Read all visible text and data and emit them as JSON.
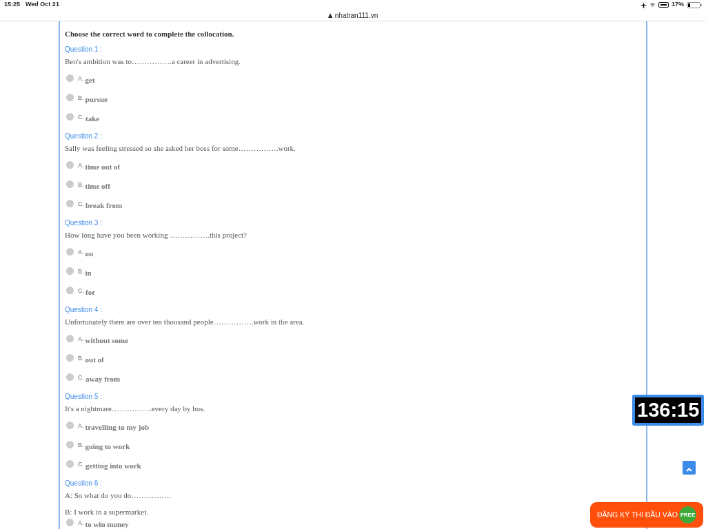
{
  "status_bar": {
    "time": "15:25",
    "date": "Wed Oct 21",
    "battery": "17%"
  },
  "address_bar": {
    "url": "nhatran111.vn"
  },
  "quiz": {
    "instruction": "Choose the correct word to complete the collocation.",
    "questions": [
      {
        "label": "Question 1 :",
        "lines": [
          "Ben's ambition was to…………….a career in advertising."
        ],
        "options": [
          {
            "letter": "A.",
            "text": "get",
            "selected": false
          },
          {
            "letter": "B.",
            "text": "pursue",
            "selected": false
          },
          {
            "letter": "C.",
            "text": "take",
            "selected": false
          }
        ]
      },
      {
        "label": "Question 2 :",
        "lines": [
          "Sally was feeling stressed so she asked her boss for some…………….work."
        ],
        "options": [
          {
            "letter": "A.",
            "text": "time out of",
            "selected": false
          },
          {
            "letter": "B.",
            "text": "time off",
            "selected": false
          },
          {
            "letter": "C.",
            "text": "break from",
            "selected": false
          }
        ]
      },
      {
        "label": "Question 3 :",
        "lines": [
          "How long have you been working …………….this project?"
        ],
        "options": [
          {
            "letter": "A.",
            "text": "on",
            "selected": false
          },
          {
            "letter": "B.",
            "text": "in",
            "selected": false
          },
          {
            "letter": "C.",
            "text": "for",
            "selected": false
          }
        ]
      },
      {
        "label": "Question 4 :",
        "lines": [
          "Unfortunately there are over ten thousand people…………….work in the area."
        ],
        "options": [
          {
            "letter": "A.",
            "text": "without some",
            "selected": false
          },
          {
            "letter": "B.",
            "text": "out of",
            "selected": false
          },
          {
            "letter": "C.",
            "text": "away from",
            "selected": false
          }
        ]
      },
      {
        "label": "Question 5 :",
        "lines": [
          "It's a nightmare…………….every day by bus."
        ],
        "options": [
          {
            "letter": "A.",
            "text": "travelling to my job",
            "selected": false
          },
          {
            "letter": "B.",
            "text": "going to work",
            "selected": false
          },
          {
            "letter": "C.",
            "text": "getting into work",
            "selected": false
          }
        ]
      },
      {
        "label": "Question 6 :",
        "lines": [
          "A: So what do you do…………….",
          "B: I work in a supermarket."
        ],
        "options": [
          {
            "letter": "A.",
            "text": "to win money",
            "selected": false
          }
        ]
      }
    ]
  },
  "timer": "136:15",
  "register_button": {
    "label": "ĐĂNG KÝ THI ĐẦU VÀO",
    "badge": "FREE"
  }
}
